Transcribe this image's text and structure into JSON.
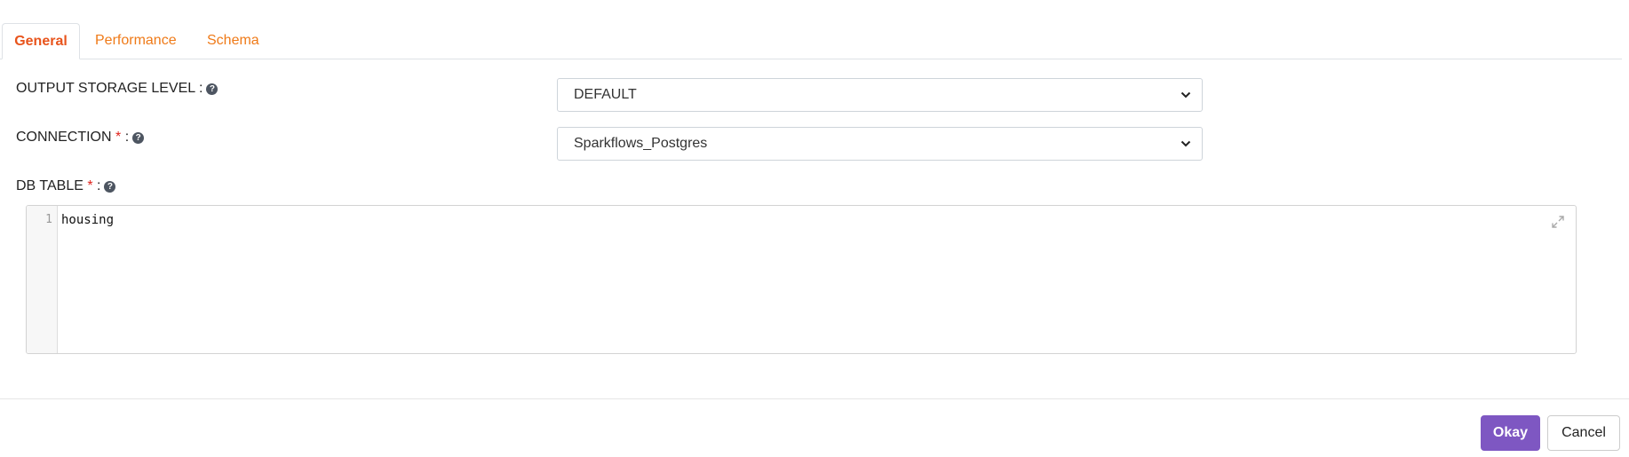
{
  "tabs": [
    {
      "label": "General",
      "active": true
    },
    {
      "label": "Performance",
      "active": false
    },
    {
      "label": "Schema",
      "active": false
    }
  ],
  "form": {
    "output_storage_level": {
      "label": "OUTPUT STORAGE LEVEL",
      "suffix": " :",
      "value": "DEFAULT"
    },
    "connection": {
      "label": "CONNECTION",
      "required_mark": "*",
      "suffix": " :",
      "value": "Sparkflows_Postgres"
    },
    "db_table": {
      "label": "DB TABLE",
      "required_mark": "*",
      "suffix": " :",
      "line_number": "1",
      "value": "housing"
    }
  },
  "footer": {
    "okay_label": "Okay",
    "cancel_label": "Cancel"
  },
  "icons": {
    "help": "question-circle-icon",
    "dropdown": "chevron-down-icon",
    "expand": "expand-icon"
  },
  "colors": {
    "tab": "#ef7a18",
    "tab_active": "#e8541c",
    "required": "#e0231c",
    "primary_button": "#7e57c2"
  }
}
